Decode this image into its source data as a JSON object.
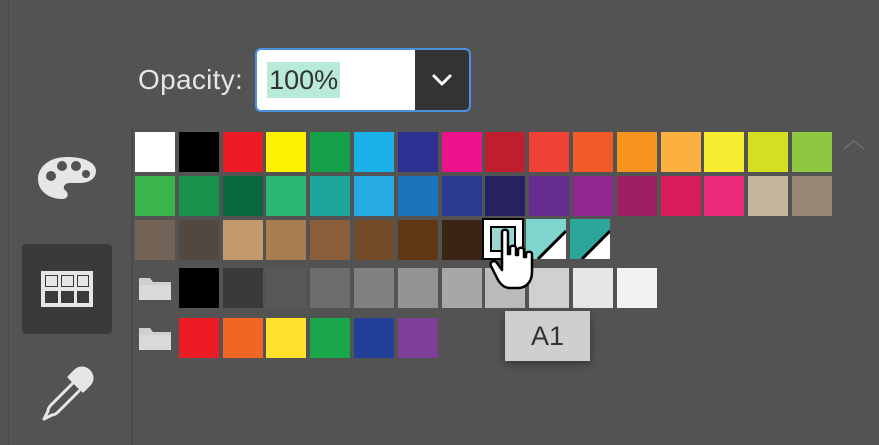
{
  "opacity": {
    "label": "Opacity:",
    "value": "100%"
  },
  "tooltip": "A1",
  "icons": {
    "palette": "palette-icon",
    "swatches": "swatches-grid-icon",
    "eyedropper": "eyedropper-icon",
    "folder": "folder-icon",
    "dropdown": "chevron-down-icon",
    "cursor": "hand-pointer-icon"
  },
  "swatch_rows": {
    "row1": [
      "#ffffff",
      "#000000",
      "#ed1c24",
      "#fff200",
      "#15a04a",
      "#1cb0e9",
      "#2e3192",
      "#ec138c",
      "#be1e2d",
      "#ef4136",
      "#f15a29",
      "#f7941d",
      "#fbb040",
      "#f9ed32",
      "#d7df23",
      "#8dc63f"
    ],
    "row2": [
      "#3ab54a",
      "#16924a",
      "#07673d",
      "#2bb673",
      "#1ba59b",
      "#27aae1",
      "#1c75bc",
      "#2b3990",
      "#262262",
      "#662d91",
      "#92278f",
      "#9e1f63",
      "#da1c5c",
      "#ee2a7b",
      "#c2b59b",
      "#998675"
    ],
    "row3": [
      "#736357",
      "#534741",
      "#c49a6c",
      "#a97c50",
      "#8b5e3c",
      "#754c29",
      "#603913",
      "#3c2415"
    ],
    "grays": [
      "#000000",
      "#3a3a3a",
      "#575757",
      "#6d6d6d",
      "#808080",
      "#939393",
      "#a7a7a7",
      "#bbbbbb",
      "#d0d0d0",
      "#e6e6e6",
      "#f2f2f2"
    ],
    "brights": [
      "#ed1c24",
      "#f26522",
      "#fde12d",
      "#1aa64a",
      "#22409a",
      "#7d3f98"
    ],
    "teal_pair": [
      "#80d5cf",
      "#2da69a"
    ]
  }
}
